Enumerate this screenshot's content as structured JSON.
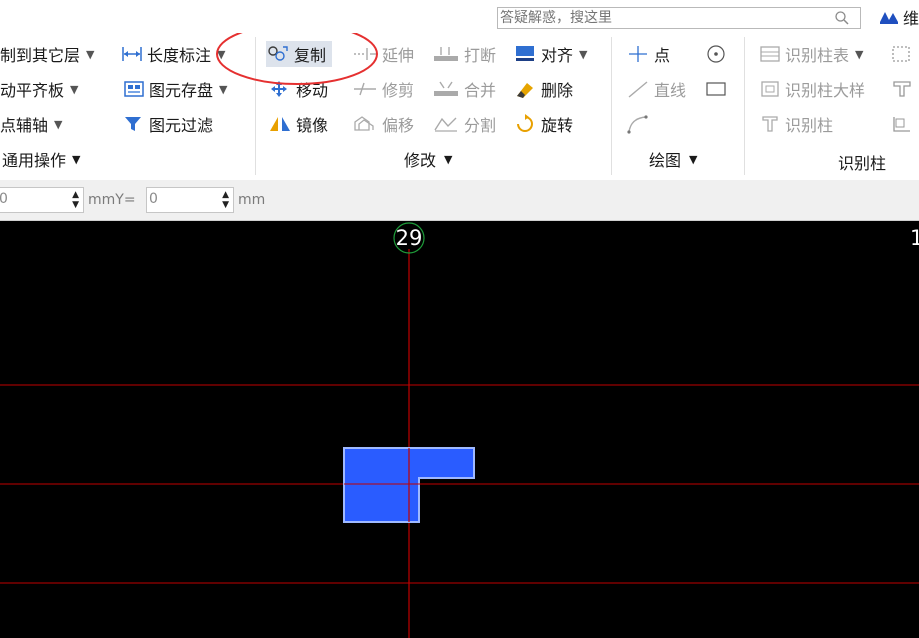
{
  "search": {
    "placeholder": "答疑解惑，搜这里"
  },
  "brand": {
    "label": "维"
  },
  "ribbon": {
    "general": {
      "copy_to_layers": "制到其它层",
      "auto_align_slab": "动平齐板",
      "point_axis": "点辅轴",
      "group_label": "通用操作"
    },
    "dimension": {
      "length_dim": "长度标注",
      "element_store": "图元存盘",
      "element_filter": "图元过滤"
    },
    "modify": {
      "copy": "复制",
      "move": "移动",
      "mirror": "镜像",
      "extend": "延伸",
      "trim": "修剪",
      "offset": "偏移",
      "break": "打断",
      "merge": "合并",
      "split": "分割",
      "align": "对齐",
      "delete": "删除",
      "rotate": "旋转",
      "group_label": "修改"
    },
    "draw": {
      "point": "点",
      "line": "直线",
      "group_label": "绘图"
    },
    "identify": {
      "column_table": "识别柱表",
      "column_detail": "识别柱大样",
      "column": "识别柱",
      "group_label": "识别柱"
    }
  },
  "coords": {
    "x_value": "0",
    "x_unit": "mm",
    "y_label": "Y=",
    "y_value": "0",
    "y_unit": "mm"
  },
  "canvas": {
    "axis_label": "29",
    "axis_label_right": "1",
    "colors": {
      "background": "#000000",
      "grid_line": "#c00000",
      "element_fill": "#2a5cff",
      "element_stroke": "#9fb9ff",
      "highlight_ellipse": "#e53030"
    }
  }
}
